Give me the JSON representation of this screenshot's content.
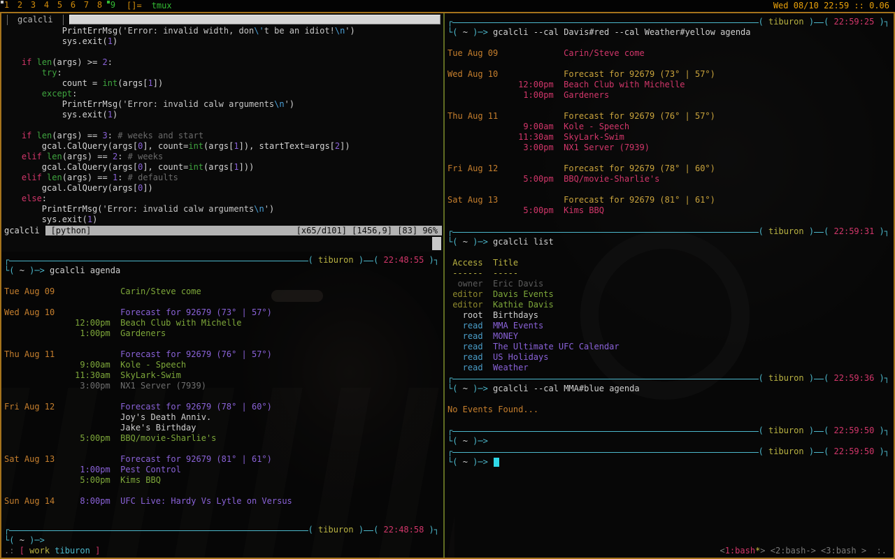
{
  "topbar": {
    "tags": [
      "1",
      "2",
      "3",
      "4",
      "5",
      "6",
      "7",
      "8",
      "9"
    ],
    "active_tag": "9",
    "occupied_tag": "1",
    "layout_symbol": "[]=",
    "window_title": "tmux",
    "clock": "Wed 08/10 22:59 :: 0.06"
  },
  "colors": {
    "accent_cyan": "#4cb8cc",
    "host_yellow": "#b9b242",
    "time_pink": "#d2366a",
    "date_orange": "#c67f2d",
    "event_green": "#7ea83a",
    "event_purple": "#8a62d8",
    "forecast_yellow": "#c9a33c",
    "topbar_orange": "#cf8a0a",
    "topbar_green": "#33bb33",
    "frame_orange": "#a5731c",
    "pane_divider": "#5f6b22"
  },
  "vim_pane": {
    "tab_label": "gcalcli",
    "statusline": {
      "file": "gcalcli",
      "filetype": "[python]",
      "right": "[x65/d101] [1456,9] [83] 96%"
    },
    "code_lines": [
      [
        [
          "w",
          "            PrintErrMsg("
        ],
        [
          "str",
          "'Error: invalid width, don"
        ],
        [
          "esc",
          "\\'"
        ],
        [
          "str",
          "t be an idiot!"
        ],
        [
          "esc",
          "\\n"
        ],
        [
          "str",
          "'"
        ],
        [
          "w",
          ")"
        ]
      ],
      [
        [
          "w",
          "            sys.exit("
        ],
        [
          "num",
          "1"
        ],
        [
          "w",
          ")"
        ]
      ],
      [],
      [
        [
          "kw",
          "    if"
        ],
        [
          "w",
          " "
        ],
        [
          "fn",
          "len"
        ],
        [
          "w",
          "(args) >= "
        ],
        [
          "num",
          "2"
        ],
        [
          "w",
          ":"
        ]
      ],
      [
        [
          "fn",
          "        try"
        ],
        [
          "w",
          ":"
        ]
      ],
      [
        [
          "w",
          "            count = "
        ],
        [
          "fn",
          "int"
        ],
        [
          "w",
          "(args["
        ],
        [
          "num",
          "1"
        ],
        [
          "w",
          "])"
        ]
      ],
      [
        [
          "fn",
          "        except"
        ],
        [
          "w",
          ":"
        ]
      ],
      [
        [
          "w",
          "            PrintErrMsg("
        ],
        [
          "str",
          "'Error: invalid calw arguments"
        ],
        [
          "esc",
          "\\n"
        ],
        [
          "str",
          "'"
        ],
        [
          "w",
          ")"
        ]
      ],
      [
        [
          "w",
          "            sys.exit("
        ],
        [
          "num",
          "1"
        ],
        [
          "w",
          ")"
        ]
      ],
      [],
      [
        [
          "kw",
          "    if"
        ],
        [
          "w",
          " "
        ],
        [
          "fn",
          "len"
        ],
        [
          "w",
          "(args) == "
        ],
        [
          "num",
          "3"
        ],
        [
          "w",
          ": "
        ],
        [
          "com",
          "# weeks and start"
        ]
      ],
      [
        [
          "w",
          "        gcal.CalQuery(args["
        ],
        [
          "num",
          "0"
        ],
        [
          "w",
          "], count="
        ],
        [
          "fn",
          "int"
        ],
        [
          "w",
          "(args["
        ],
        [
          "num",
          "1"
        ],
        [
          "w",
          "]), startText=args["
        ],
        [
          "num",
          "2"
        ],
        [
          "w",
          "])"
        ]
      ],
      [
        [
          "kw",
          "    elif"
        ],
        [
          "w",
          " "
        ],
        [
          "fn",
          "len"
        ],
        [
          "w",
          "(args) == "
        ],
        [
          "num",
          "2"
        ],
        [
          "w",
          ": "
        ],
        [
          "com",
          "# weeks"
        ]
      ],
      [
        [
          "w",
          "        gcal.CalQuery(args["
        ],
        [
          "num",
          "0"
        ],
        [
          "w",
          "], count="
        ],
        [
          "fn",
          "int"
        ],
        [
          "w",
          "(args["
        ],
        [
          "num",
          "1"
        ],
        [
          "w",
          "]))"
        ]
      ],
      [
        [
          "kw",
          "    elif"
        ],
        [
          "w",
          " "
        ],
        [
          "fn",
          "len"
        ],
        [
          "w",
          "(args) == "
        ],
        [
          "num",
          "1"
        ],
        [
          "w",
          ": "
        ],
        [
          "com",
          "# defaults"
        ]
      ],
      [
        [
          "w",
          "        gcal.CalQuery(args["
        ],
        [
          "num",
          "0"
        ],
        [
          "w",
          "])"
        ]
      ],
      [
        [
          "kw",
          "    else"
        ],
        [
          "w",
          ":"
        ]
      ],
      [
        [
          "w",
          "        PrintErrMsg("
        ],
        [
          "str",
          "'Error: invalid calw arguments"
        ],
        [
          "esc",
          "\\n"
        ],
        [
          "str",
          "'"
        ],
        [
          "w",
          ")"
        ]
      ],
      [
        [
          "w",
          "        sys.exit("
        ],
        [
          "num",
          "1"
        ],
        [
          "w",
          ")"
        ]
      ]
    ]
  },
  "left_terminal": {
    "host": "tiburon",
    "header_time": "22:48:55",
    "prompt_path": "~",
    "command": "gcalcli agenda",
    "agenda": [
      {
        "date": "Tue Aug 09",
        "events": [
          {
            "time": "",
            "title": "Carin/Steve come",
            "color": "green"
          }
        ]
      },
      {
        "date": "Wed Aug 10",
        "events": [
          {
            "time": "",
            "title": "Forecast for 92679 (73° | 57°)",
            "color": "purple"
          },
          {
            "time": "12:00pm",
            "title": "Beach Club with Michelle",
            "color": "green"
          },
          {
            "time": "1:00pm",
            "title": "Gardeners",
            "color": "green"
          }
        ]
      },
      {
        "date": "Thu Aug 11",
        "events": [
          {
            "time": "",
            "title": "Forecast for 92679 (76° | 57°)",
            "color": "purple"
          },
          {
            "time": "9:00am",
            "title": "Kole - Speech",
            "color": "green"
          },
          {
            "time": "11:30am",
            "title": "SkyLark-Swim",
            "color": "green"
          },
          {
            "time": "3:00pm",
            "title": "NX1 Server (7939)",
            "color": "grey"
          }
        ]
      },
      {
        "date": "Fri Aug 12",
        "events": [
          {
            "time": "",
            "title": "Forecast for 92679 (78° | 60°)",
            "color": "purple"
          },
          {
            "time": "",
            "title": "Joy's Death Anniv.",
            "color": "white"
          },
          {
            "time": "",
            "title": "Jake's Birthday",
            "color": "white"
          },
          {
            "time": "5:00pm",
            "title": "BBQ/movie-Sharlie's",
            "color": "green"
          }
        ]
      },
      {
        "date": "Sat Aug 13",
        "events": [
          {
            "time": "",
            "title": "Forecast for 92679 (81° | 61°)",
            "color": "purple"
          },
          {
            "time": "1:00pm",
            "title": "Pest Control",
            "color": "purple"
          },
          {
            "time": "5:00pm",
            "title": "Kims BBQ",
            "color": "green"
          }
        ]
      },
      {
        "date": "Sun Aug 14",
        "events": [
          {
            "time": "8:00pm",
            "title": "UFC Live: Hardy Vs Lytle on Versus",
            "color": "purple"
          }
        ]
      }
    ],
    "footer_time": "22:48:58",
    "screen_status": {
      "dots": ".:",
      "bracket_open": "[",
      "session": "work",
      "host": "tiburon",
      "bracket_close": "]"
    }
  },
  "right_terminal": {
    "host": "tiburon",
    "prompt_path": "~",
    "blocks": [
      {
        "time": "22:59:25",
        "command": "gcalcli --cal Davis#red --cal Weather#yellow agenda",
        "type": "agenda",
        "agenda": [
          {
            "date": "Tue Aug 09",
            "events": [
              {
                "time": "",
                "title": "Carin/Steve come",
                "color": "pink"
              }
            ]
          },
          {
            "date": "Wed Aug 10",
            "events": [
              {
                "time": "",
                "title": "Forecast for 92679 (73° | 57°)",
                "color": "yellow"
              },
              {
                "time": "12:00pm",
                "title": "Beach Club with Michelle",
                "color": "pink"
              },
              {
                "time": "1:00pm",
                "title": "Gardeners",
                "color": "pink"
              }
            ]
          },
          {
            "date": "Thu Aug 11",
            "events": [
              {
                "time": "",
                "title": "Forecast for 92679 (76° | 57°)",
                "color": "yellow"
              },
              {
                "time": "9:00am",
                "title": "Kole - Speech",
                "color": "pink"
              },
              {
                "time": "11:30am",
                "title": "SkyLark-Swim",
                "color": "pink"
              },
              {
                "time": "3:00pm",
                "title": "NX1 Server (7939)",
                "color": "pink"
              }
            ]
          },
          {
            "date": "Fri Aug 12",
            "events": [
              {
                "time": "",
                "title": "Forecast for 92679 (78° | 60°)",
                "color": "yellow"
              },
              {
                "time": "5:00pm",
                "title": "BBQ/movie-Sharlie's",
                "color": "pink"
              }
            ]
          },
          {
            "date": "Sat Aug 13",
            "events": [
              {
                "time": "",
                "title": "Forecast for 92679 (81° | 61°)",
                "color": "yellow"
              },
              {
                "time": "5:00pm",
                "title": "Kims BBQ",
                "color": "pink"
              }
            ]
          }
        ]
      },
      {
        "time": "22:59:31",
        "command": "gcalcli list",
        "type": "table",
        "table": {
          "headers": [
            "Access",
            "Title"
          ],
          "underline": [
            "------",
            "-----"
          ],
          "rows": [
            {
              "access": "owner",
              "title": "Eric Davis",
              "access_color": "dim",
              "title_color": "dim"
            },
            {
              "access": "editor",
              "title": "Davis Events",
              "access_color": "olive",
              "title_color": "green"
            },
            {
              "access": "editor",
              "title": "Kathie Davis",
              "access_color": "olive",
              "title_color": "green"
            },
            {
              "access": "root",
              "title": "Birthdays",
              "access_color": "white",
              "title_color": "white"
            },
            {
              "access": "read",
              "title": "MMA Events",
              "access_color": "blue",
              "title_color": "purple"
            },
            {
              "access": "read",
              "title": "MONEY",
              "access_color": "blue",
              "title_color": "purple"
            },
            {
              "access": "read",
              "title": "The Ultimate UFC Calendar",
              "access_color": "blue",
              "title_color": "purple"
            },
            {
              "access": "read",
              "title": "US Holidays",
              "access_color": "blue",
              "title_color": "purple"
            },
            {
              "access": "read",
              "title": "Weather",
              "access_color": "blue",
              "title_color": "purple"
            }
          ]
        }
      },
      {
        "time": "22:59:36",
        "command": "gcalcli --cal MMA#blue agenda",
        "type": "message",
        "message": "No Events Found..."
      },
      {
        "time": "22:59:50",
        "command": "",
        "type": "empty"
      },
      {
        "time": "22:59:50",
        "command": "",
        "type": "cursor"
      }
    ],
    "screen_status": {
      "windows": [
        {
          "text": "1:bash",
          "flag": "*",
          "active": true
        },
        {
          "text": "2:bash",
          "flag": "-",
          "active": false
        },
        {
          "text": "3:bash",
          "flag": " ",
          "active": false
        }
      ],
      "suffix": ":."
    }
  }
}
